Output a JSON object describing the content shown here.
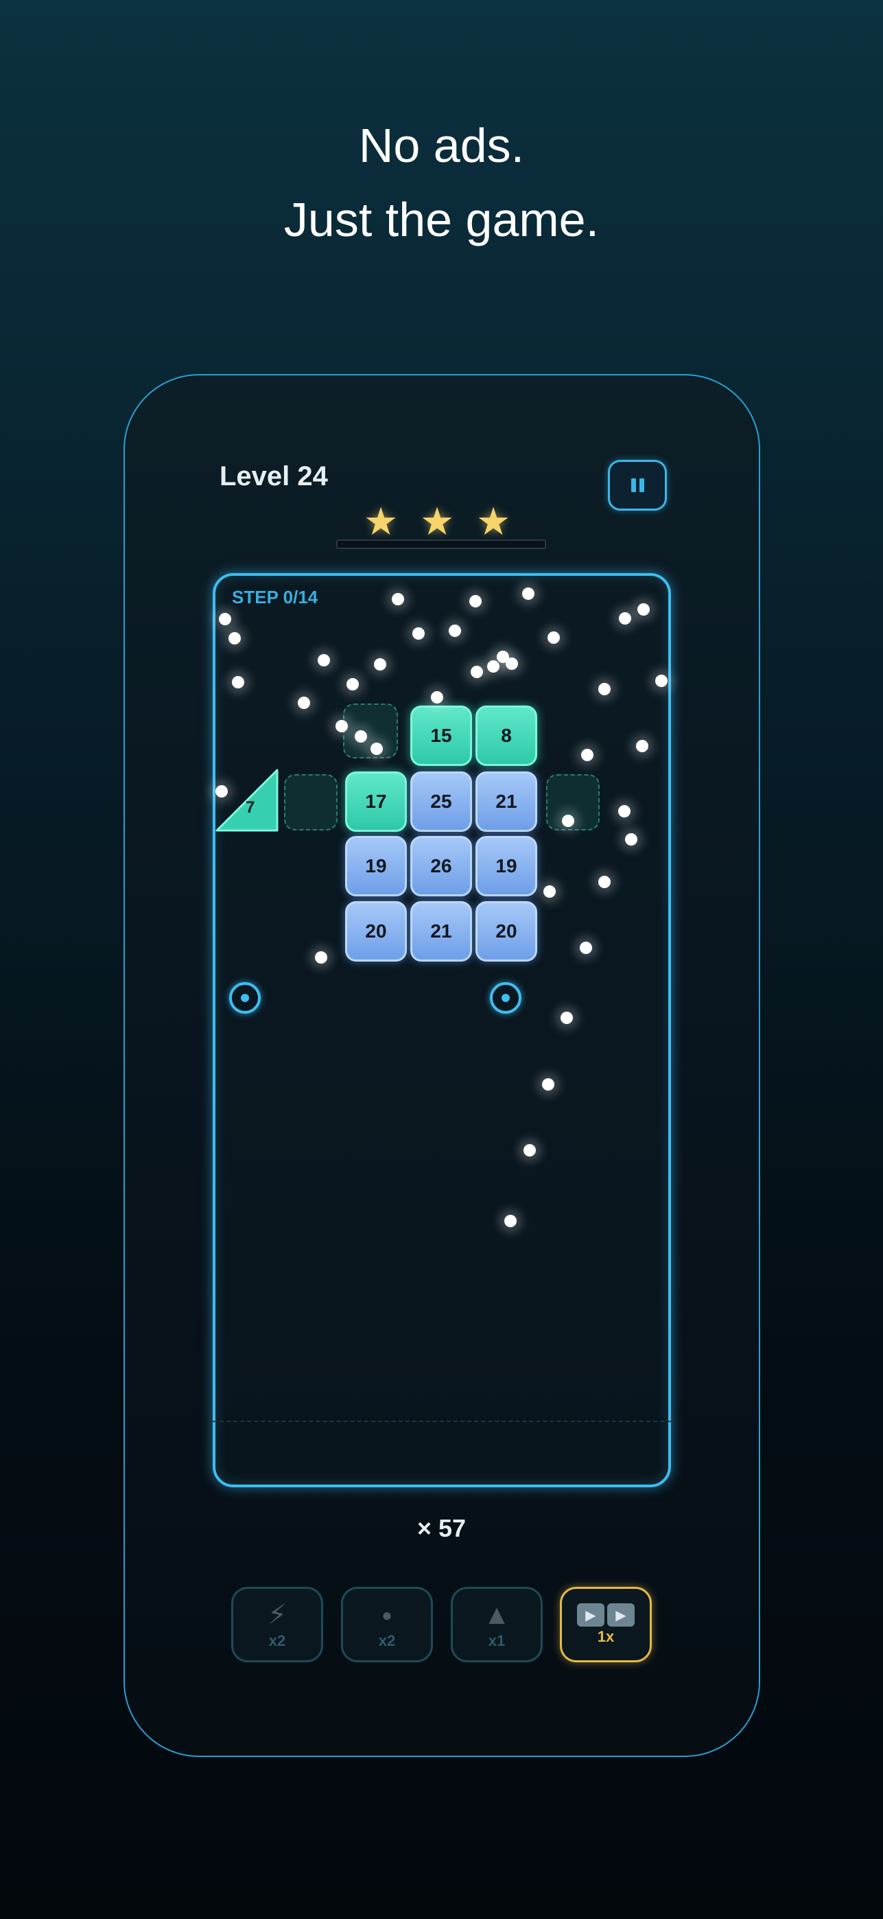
{
  "headline": {
    "line1": "No ads.",
    "line2": "Just the game."
  },
  "game": {
    "level_label": "Level 24",
    "stars_earned": 3,
    "stars_total": 3,
    "step_label": "STEP 0/14",
    "ball_count_label": "× 57",
    "bricks": [
      {
        "value": "15",
        "color": "teal"
      },
      {
        "value": "8",
        "color": "teal"
      },
      {
        "value": "17",
        "color": "teal"
      },
      {
        "value": "25",
        "color": "blue"
      },
      {
        "value": "21",
        "color": "blue"
      },
      {
        "value": "19",
        "color": "blue"
      },
      {
        "value": "26",
        "color": "blue"
      },
      {
        "value": "19",
        "color": "blue"
      },
      {
        "value": "20",
        "color": "blue"
      },
      {
        "value": "21",
        "color": "blue"
      },
      {
        "value": "20",
        "color": "blue"
      }
    ],
    "triangle_brick_value": "7"
  },
  "powerups": [
    {
      "icon": "lightning-icon",
      "glyph": "⚡",
      "count": "x2"
    },
    {
      "icon": "ball-icon",
      "glyph": "●",
      "count": "x2"
    },
    {
      "icon": "triangle-icon",
      "glyph": "▲",
      "count": "x1"
    },
    {
      "icon": "fast-forward-icon",
      "glyph": "▶▶",
      "count": "1x"
    }
  ],
  "colors": {
    "accent_blue": "#3fbdf0",
    "brick_teal": "#2ec9a9",
    "brick_blue": "#6f9fe9",
    "star_yellow": "#f6d46c",
    "active_gold": "#e6b948"
  }
}
